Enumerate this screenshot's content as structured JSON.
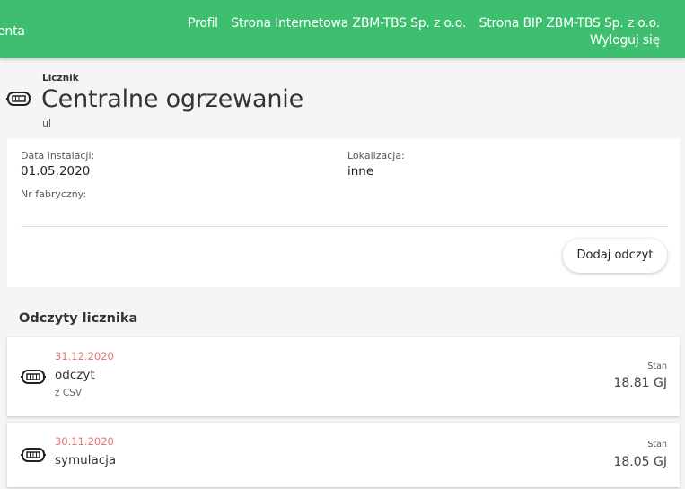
{
  "topbar": {
    "cut_text": "enta",
    "nav_items": [
      "Profil",
      "Strona Internetowa ZBM-TBS Sp. z o.o.",
      "Strona BIP ZBM-TBS Sp. z o.o."
    ],
    "logout": "Wyloguj się",
    "color": "#3dbf6f"
  },
  "header": {
    "label": "Licznik",
    "title": "Centralne ogrzewanie",
    "address": "ul",
    "icon": "meter-icon"
  },
  "details": {
    "install_label": "Data instalacji:",
    "install_value": "01.05.2020",
    "location_label": "Lokalizacja:",
    "location_value": "inne",
    "serial_label": "Nr fabryczny:",
    "add_button": "Dodaj odczyt"
  },
  "readings": {
    "section_title": "Odczyty licznika",
    "items": [
      {
        "date": "31.12.2020",
        "name": "odczyt",
        "source": "z CSV",
        "stan_label": "Stan",
        "value": "18.81 GJ"
      },
      {
        "date": "30.11.2020",
        "name": "symulacja",
        "source": "",
        "stan_label": "Stan",
        "value": "18.05 GJ"
      }
    ],
    "date_color": "#e57373"
  }
}
